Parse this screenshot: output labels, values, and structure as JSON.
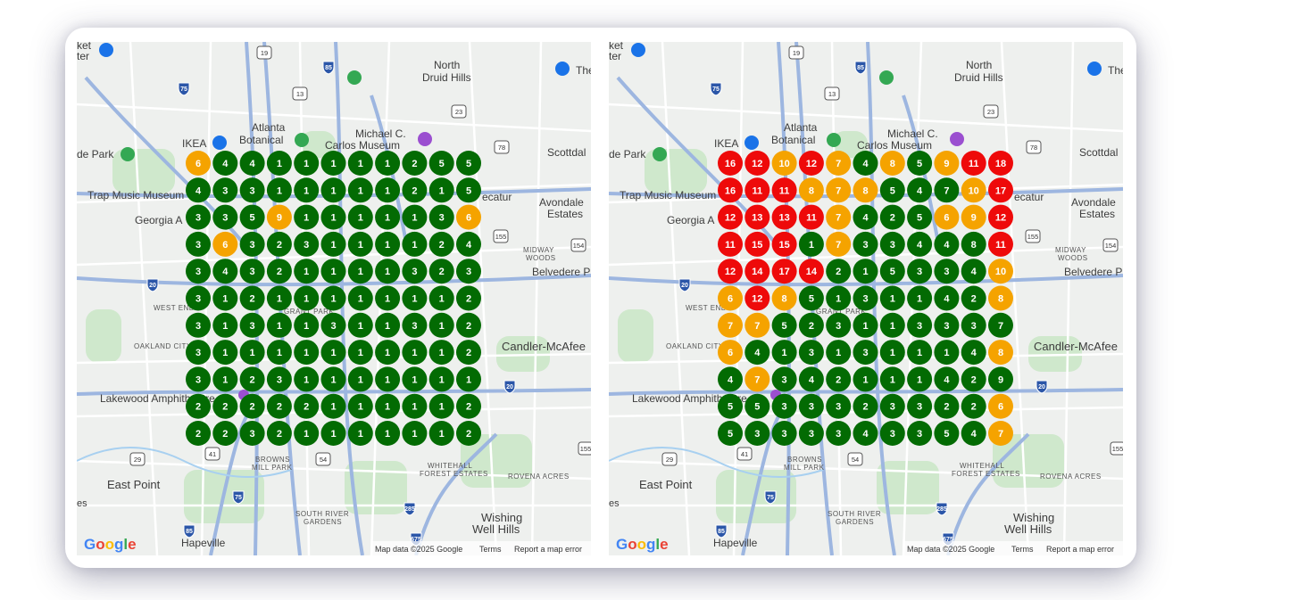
{
  "colors": {
    "green": "#036b03",
    "orange": "#f5a300",
    "red": "#ee0a0a"
  },
  "maps": [
    {
      "name": "left",
      "grid": [
        [
          6,
          4,
          4,
          1,
          1,
          1,
          1,
          1,
          2,
          5,
          5
        ],
        [
          4,
          3,
          3,
          1,
          1,
          1,
          1,
          1,
          2,
          1,
          5
        ],
        [
          3,
          3,
          5,
          9,
          1,
          1,
          1,
          1,
          1,
          3,
          6
        ],
        [
          3,
          6,
          3,
          2,
          3,
          1,
          1,
          1,
          1,
          2,
          4
        ],
        [
          3,
          4,
          3,
          2,
          1,
          1,
          1,
          1,
          3,
          2,
          3
        ],
        [
          3,
          1,
          2,
          1,
          1,
          1,
          1,
          1,
          1,
          1,
          2
        ],
        [
          3,
          1,
          3,
          1,
          1,
          3,
          1,
          1,
          3,
          1,
          2
        ],
        [
          3,
          1,
          1,
          1,
          1,
          1,
          1,
          1,
          1,
          1,
          2
        ],
        [
          3,
          1,
          2,
          3,
          1,
          1,
          1,
          1,
          1,
          1,
          1
        ],
        [
          2,
          2,
          2,
          2,
          2,
          1,
          1,
          1,
          1,
          1,
          2
        ],
        [
          2,
          2,
          3,
          2,
          1,
          1,
          1,
          1,
          1,
          1,
          2
        ]
      ],
      "colors_grid": [
        "ogggggggggg",
        "ggggggggggg",
        "gggoggggggo",
        "gogggggggg",
        "ggggggggggg",
        "ggggggggggg",
        "ggggggggggg",
        "ggggggggggg",
        "ggggggggggg",
        "ggggggggggg",
        "ggggggggggg"
      ]
    },
    {
      "name": "right",
      "grid": [
        [
          16,
          12,
          10,
          12,
          7,
          4,
          8,
          5,
          9,
          11,
          18
        ],
        [
          16,
          11,
          11,
          8,
          7,
          8,
          5,
          4,
          7,
          10,
          17
        ],
        [
          12,
          13,
          13,
          11,
          7,
          4,
          2,
          5,
          6,
          9,
          12
        ],
        [
          11,
          15,
          15,
          1,
          7,
          3,
          3,
          4,
          4,
          8,
          11
        ],
        [
          12,
          14,
          17,
          14,
          2,
          1,
          5,
          3,
          3,
          4,
          10
        ],
        [
          6,
          12,
          8,
          5,
          1,
          3,
          1,
          1,
          4,
          2,
          8
        ],
        [
          7,
          7,
          5,
          2,
          3,
          1,
          1,
          3,
          3,
          3,
          7
        ],
        [
          6,
          4,
          1,
          3,
          1,
          3,
          1,
          1,
          1,
          4,
          8
        ],
        [
          4,
          7,
          3,
          4,
          2,
          1,
          1,
          1,
          4,
          2,
          9
        ],
        [
          5,
          5,
          3,
          3,
          3,
          2,
          3,
          3,
          2,
          2,
          6
        ],
        [
          5,
          3,
          3,
          3,
          3,
          4,
          3,
          3,
          5,
          4,
          7
        ]
      ],
      "colors_grid": [
        "rrorogogorr",
        "rrrooogggor",
        "rrrrogggoor",
        "rrrgogggggr",
        "rrrrggggggo",
        "orogggggggo",
        "oogggggggggo",
        "ogggggggggo",
        "gogggggggggo",
        "ggggggggggo",
        "ggggggggggo"
      ]
    }
  ],
  "labels": {
    "ket": "ket",
    "ter": "ter",
    "north": "North",
    "druid_hills": "Druid Hills",
    "the": "The",
    "atlanta": "Atlanta",
    "botanical": "Botanical",
    "ikea": "IKEA",
    "de_park": "de Park",
    "michael": "Michael C.",
    "carlos": "Carlos Museum",
    "scottdal": "Scottdal",
    "trap": "Trap Music Museum",
    "ecatur": "ecatur",
    "georgia": "Georgia A",
    "avondale": "Avondale",
    "estates": "Estates",
    "midway": "MIDWAY",
    "woods": "WOODS",
    "belvedere": "Belvedere P",
    "west_end": "WEST END",
    "grant_park": "GRANT PARK",
    "oakland_city": "OAKLAND CITY",
    "candler": "Candler-McAfee",
    "lakewood": "Lakewood Amphitheatre",
    "browns": "BROWNS",
    "mill_park": "MILL PARK",
    "whitehall": "WHITEHALL",
    "forest_estates": "FOREST ESTATES",
    "rovena": "ROVENA ACRES",
    "east_point": "East Point",
    "south_river": "SOUTH RIVER",
    "gardens": "GARDENS",
    "wishing": "Wishing",
    "well_hills": "Well Hills",
    "hapeville": "Hapeville",
    "es": "es",
    "atlanta_small": "ATLANTA"
  },
  "shields": [
    "19",
    "85",
    "75",
    "13",
    "23",
    "78",
    "155",
    "154",
    "20",
    "20",
    "41",
    "29",
    "54",
    "75",
    "285",
    "85",
    "675",
    "155"
  ],
  "footer": {
    "map_data": "Map data ©2025 Google",
    "terms": "Terms",
    "report": "Report a map error"
  },
  "logo": {
    "text": "Google",
    "letters": [
      "G",
      "o",
      "o",
      "g",
      "l",
      "e"
    ],
    "letter_colors": [
      "#4285f4",
      "#ea4335",
      "#fbbc05",
      "#4285f4",
      "#34a853",
      "#ea4335"
    ]
  }
}
